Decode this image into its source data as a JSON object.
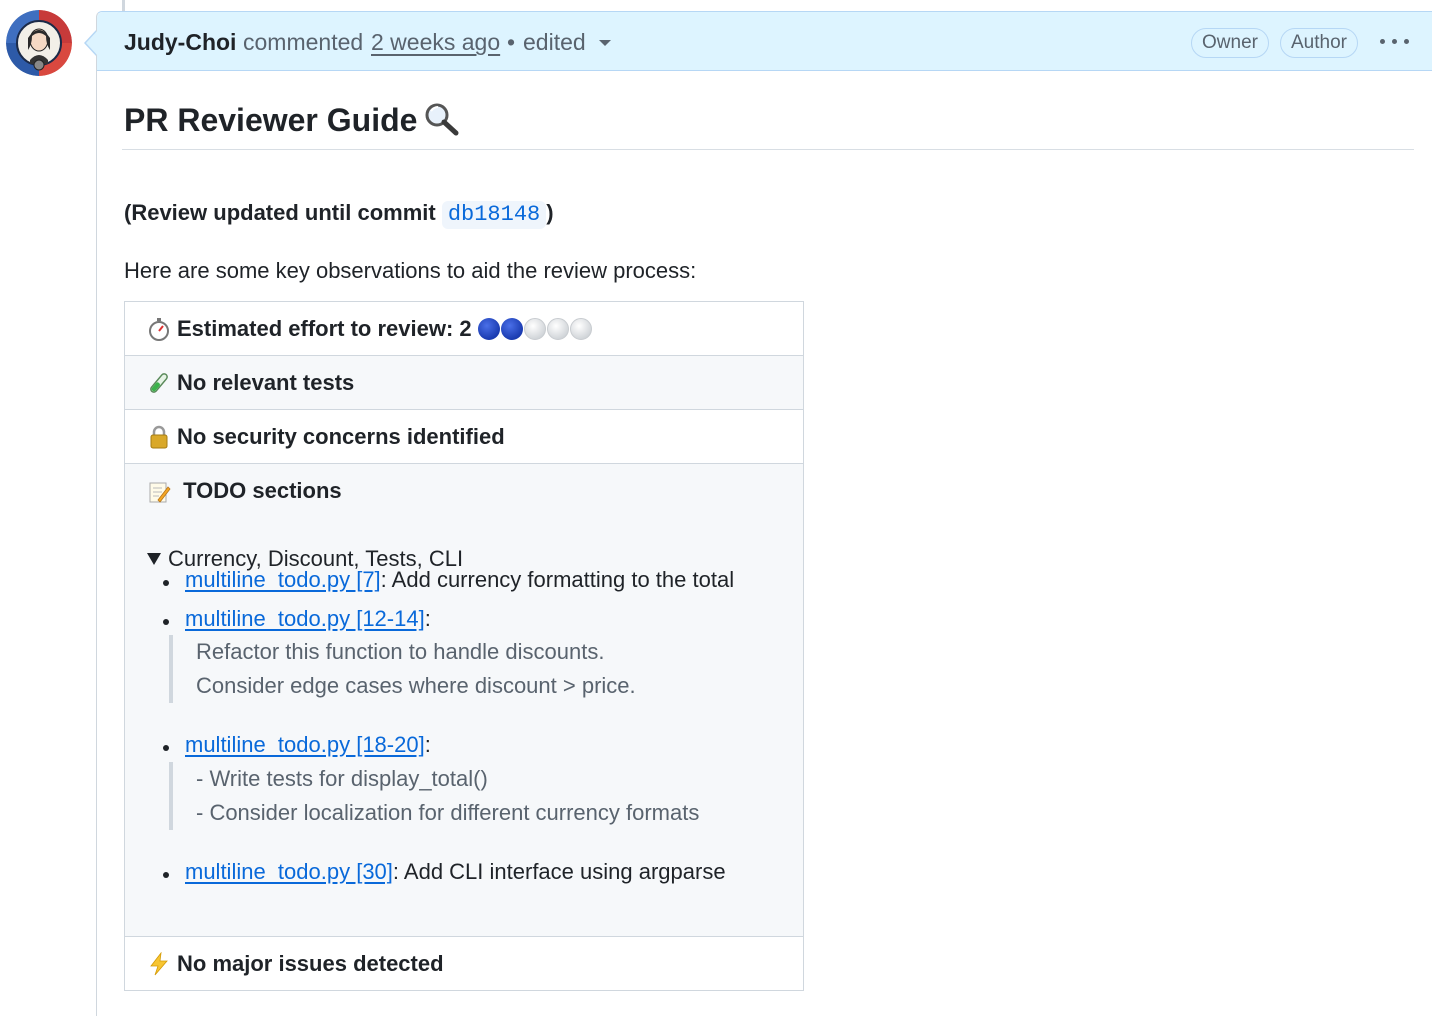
{
  "comment": {
    "author": "Judy-Choi",
    "action": "commented",
    "time": "2 weeks ago",
    "separator": "•",
    "edited": "edited",
    "badges": [
      "Owner",
      "Author"
    ]
  },
  "body": {
    "title": "PR Reviewer Guide",
    "title_icon": "magnifier-icon",
    "review_prefix": "(Review updated until commit",
    "commit": "db18148",
    "review_suffix": ")",
    "intro": "Here are some key observations to aid the review process:"
  },
  "table": {
    "effort": {
      "icon": "stopwatch-icon",
      "label": "Estimated effort to review:",
      "value": "2",
      "level": 2,
      "max": 5
    },
    "tests": {
      "icon": "test-tube-icon",
      "label": "No relevant tests"
    },
    "security": {
      "icon": "lock-icon",
      "label": "No security concerns identified"
    },
    "todo": {
      "icon": "memo-icon",
      "label": "TODO sections",
      "summary": "Currency, Discount, Tests, CLI",
      "items": [
        {
          "link": "multiline_todo.py [7]",
          "rest": ": Add currency formatting to the total"
        },
        {
          "link": "multiline_todo.py [12-14]",
          "rest": ":",
          "quote": [
            "Refactor this function to handle discounts.",
            "Consider edge cases where discount > price."
          ]
        },
        {
          "link": "multiline_todo.py [18-20]",
          "rest": ":",
          "quote": [
            "- Write tests for display_total()",
            "- Consider localization for different currency formats"
          ]
        },
        {
          "link": "multiline_todo.py [30]",
          "rest": ": Add CLI interface using argparse"
        }
      ]
    },
    "issues": {
      "icon": "lightning-icon",
      "label": "No major issues detected"
    }
  }
}
